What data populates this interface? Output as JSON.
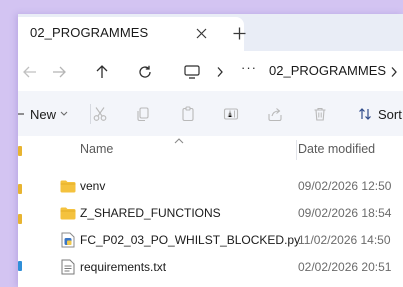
{
  "tab": {
    "title": "02_PROGRAMMES",
    "close_glyph": "✕",
    "new_tab_glyph": "+"
  },
  "navbar": {
    "path_overflow": "···",
    "current_folder": "02_PROGRAMMES",
    "separator_glyph": "›"
  },
  "commandbar": {
    "new_label": "New",
    "sort_label": "Sort"
  },
  "list": {
    "columns": {
      "name": "Name",
      "date_modified": "Date modified"
    },
    "rows": [
      {
        "name": "venv",
        "date": "09/02/2026 12:50",
        "icon": "folder-icon"
      },
      {
        "name": "Z_SHARED_FUNCTIONS",
        "date": "09/02/2026 18:54",
        "icon": "folder-icon"
      },
      {
        "name": "FC_P02_03_PO_WHILST_BLOCKED.py",
        "date": "11/02/2026 14:50",
        "icon": "python-file-icon"
      },
      {
        "name": "requirements.txt",
        "date": "02/02/2026 20:51",
        "icon": "text-file-icon"
      }
    ]
  },
  "colors": {
    "background": "#d3c4f2",
    "folder": "#f4c23e",
    "window": "#f9fafc"
  }
}
